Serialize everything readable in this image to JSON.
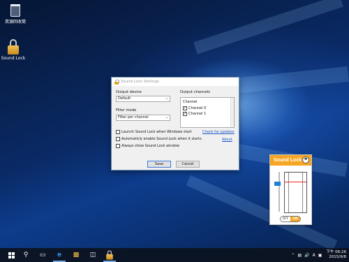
{
  "desktop": {
    "icons": [
      {
        "label": "資源回收筒",
        "icon": "recycle-bin-icon"
      },
      {
        "label": "Sound Lock",
        "icon": "padlock-icon"
      }
    ]
  },
  "settings_window": {
    "title": "Sound Lock Settings",
    "output_device_label": "Output device",
    "output_device_value": "Default",
    "filter_mode_label": "Filter mode",
    "filter_mode_value": "Filter per channel",
    "output_channels_label": "Output channels",
    "channels_header": "Channel",
    "channels": [
      {
        "label": "Channel 0",
        "checked": true
      },
      {
        "label": "Channel 1",
        "checked": true
      }
    ],
    "options": [
      {
        "label": "Launch Sound Lock when Windows start",
        "checked": false
      },
      {
        "label": "Automaticly enable Sound Lock when it starts",
        "checked": false
      },
      {
        "label": "Always show Sound Lock window",
        "checked": false
      }
    ],
    "check_updates_link": "Check for updates",
    "about_link": "About",
    "save_button": "Save",
    "cancel_button": "Cancel"
  },
  "widget": {
    "title": "Sound Lock",
    "toggle_off": "OFF",
    "toggle_on": "ON",
    "accent": "#f6a623",
    "volume_level": 0.75,
    "limit_level": 0.78
  },
  "taskbar": {
    "items": [
      "start-icon",
      "search-icon",
      "task-view-icon",
      "edge-icon",
      "file-explorer-icon",
      "store-icon",
      "sound-lock-icon"
    ],
    "tray": {
      "ime": "A",
      "time": "下午 06:26",
      "date": "2015/9/8"
    }
  }
}
